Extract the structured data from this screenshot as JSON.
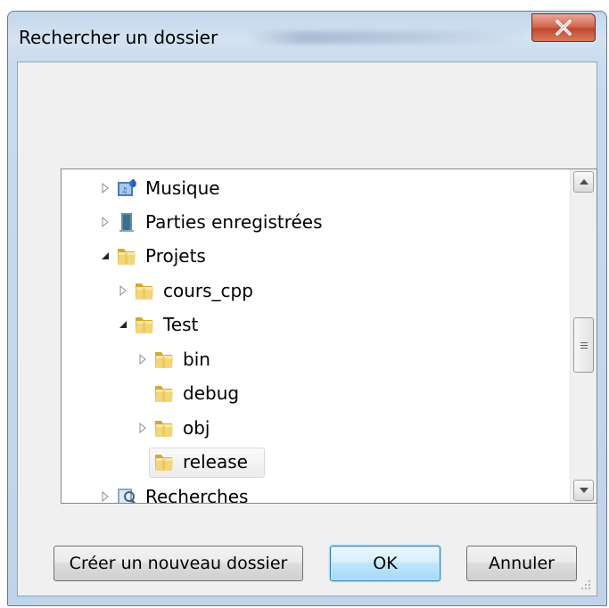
{
  "window": {
    "title": "Rechercher un dossier",
    "close_label": "X"
  },
  "tree": {
    "items": [
      {
        "label": "Musique",
        "expander": "collapsed",
        "icon": "music-library-icon"
      },
      {
        "label": "Parties enregistrées",
        "expander": "collapsed",
        "icon": "saved-games-icon"
      },
      {
        "label": "Projets",
        "expander": "expanded",
        "icon": "folder-icon"
      },
      {
        "label": "cours_cpp",
        "expander": "collapsed",
        "icon": "folder-icon"
      },
      {
        "label": "Test",
        "expander": "expanded",
        "icon": "folder-icon"
      },
      {
        "label": "bin",
        "expander": "collapsed",
        "icon": "folder-icon"
      },
      {
        "label": "debug",
        "expander": "none",
        "icon": "folder-icon"
      },
      {
        "label": "obj",
        "expander": "collapsed",
        "icon": "folder-icon"
      },
      {
        "label": "release",
        "expander": "none",
        "icon": "folder-icon",
        "selected": true
      },
      {
        "label": "Recherches",
        "expander": "collapsed",
        "icon": "search-folder-icon"
      }
    ]
  },
  "buttons": {
    "new_folder": "Créer un nouveau dossier",
    "ok": "OK",
    "cancel": "Annuler"
  },
  "colors": {
    "frame": "#c3d6eb",
    "close_button": "#c0492f",
    "default_button_border": "#3c7fb1",
    "folder_yellow": "#e8c04a"
  }
}
